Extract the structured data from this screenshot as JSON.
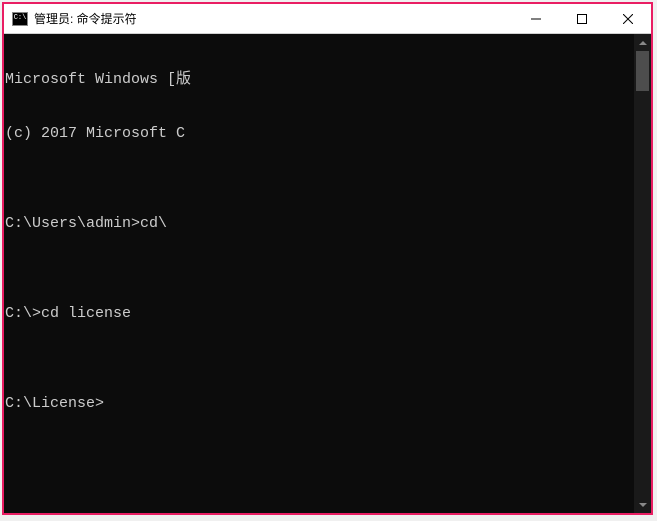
{
  "titlebar": {
    "icon_text": "C:\\",
    "title": "管理员: 命令提示符"
  },
  "terminal": {
    "lines": [
      "Microsoft Windows [版",
      "(c) 2017 Microsoft C",
      "",
      "C:\\Users\\admin>cd\\",
      "",
      "C:\\>cd license",
      "",
      "C:\\License>"
    ]
  }
}
